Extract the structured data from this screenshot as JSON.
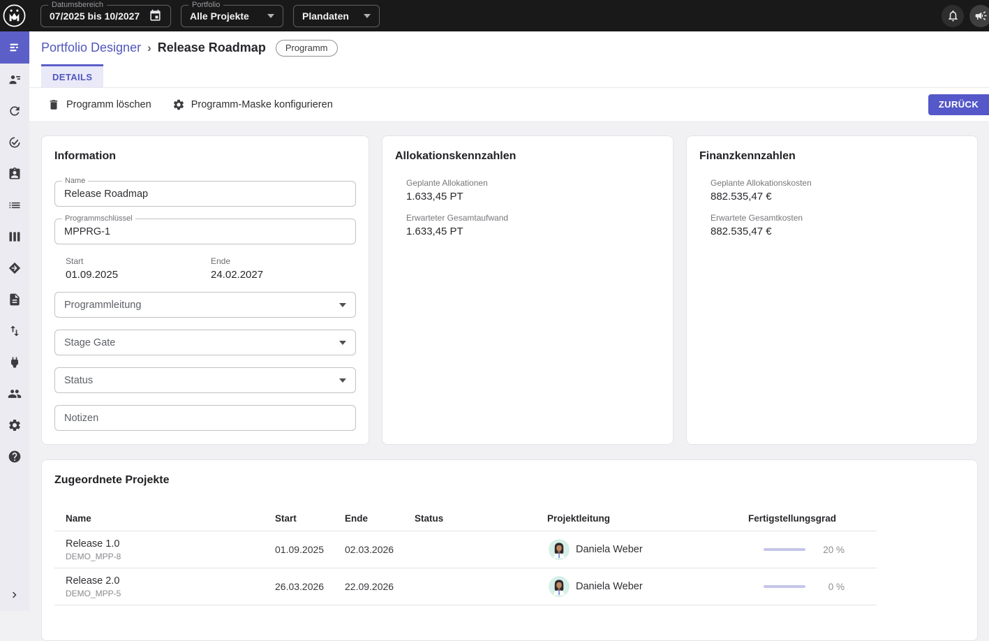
{
  "colors": {
    "accent": "#5b5fc7",
    "topbar_bg": "#191919",
    "sidebar_bg": "#ebebf1",
    "content_bg": "#f1f1f4",
    "progress_track": "#c5c6e9"
  },
  "topbar": {
    "logo": "meisterplan-logo",
    "date_range": {
      "label": "Datumsbereich",
      "value": "07/2025 bis 10/2027",
      "icon": "calendar-icon"
    },
    "portfolio": {
      "label": "Portfolio",
      "value": "Alle Projekte"
    },
    "plan_data": {
      "value": "Plandaten"
    },
    "right_icons": [
      "notifications-bell-icon",
      "announcements-megaphone-icon"
    ]
  },
  "sidebar": {
    "icons": [
      "portfolio-designer",
      "resource-assignment",
      "sync",
      "goals-target",
      "badge-id",
      "list",
      "board-columns",
      "milestone-diamond",
      "report-document",
      "import-export",
      "integrations-plug",
      "users",
      "settings",
      "help"
    ],
    "expand": "chevron-right"
  },
  "breadcrumb": {
    "parent": "Portfolio Designer",
    "separator": "›",
    "current": "Release Roadmap",
    "badge": "Programm"
  },
  "tabs": {
    "details": "DETAILS"
  },
  "toolbar": {
    "delete_label": "Programm löschen",
    "configure_label": "Programm-Maske konfigurieren",
    "back_label": "ZURÜCK"
  },
  "info_card": {
    "title": "Information",
    "name": {
      "label": "Name",
      "value": "Release Roadmap"
    },
    "program_key": {
      "label": "Programmschlüssel",
      "value": "MPPRG-1"
    },
    "start": {
      "label": "Start",
      "value": "01.09.2025"
    },
    "end": {
      "label": "Ende",
      "value": "24.02.2027"
    },
    "program_lead": {
      "placeholder": "Programmleitung"
    },
    "stage_gate": {
      "placeholder": "Stage Gate"
    },
    "status": {
      "placeholder": "Status"
    },
    "notes": {
      "placeholder": "Notizen"
    }
  },
  "allocation_card": {
    "title": "Allokationskennzahlen",
    "metrics": [
      {
        "label": "Geplante Allokationen",
        "value": "1.633,45 PT"
      },
      {
        "label": "Erwarteter Gesamtaufwand",
        "value": "1.633,45 PT"
      }
    ]
  },
  "finance_card": {
    "title": "Finanzkennzahlen",
    "metrics": [
      {
        "label": "Geplante Allokationskosten",
        "value": "882.535,47 €"
      },
      {
        "label": "Erwartete Gesamtkosten",
        "value": "882.535,47 €"
      }
    ]
  },
  "projects": {
    "title": "Zugeordnete Projekte",
    "columns": [
      "Name",
      "Start",
      "Ende",
      "Status",
      "Projektleitung",
      "Fertigstellungsgrad"
    ],
    "rows": [
      {
        "name": "Release 1.0",
        "key": "DEMO_MPP-8",
        "start": "01.09.2025",
        "end": "02.03.2026",
        "status": "",
        "lead": "Daniela Weber",
        "progress_pct": 20,
        "progress_label": "20 %"
      },
      {
        "name": "Release 2.0",
        "key": "DEMO_MPP-5",
        "start": "26.03.2026",
        "end": "22.09.2026",
        "status": "",
        "lead": "Daniela Weber",
        "progress_pct": 0,
        "progress_label": "0 %"
      }
    ]
  }
}
